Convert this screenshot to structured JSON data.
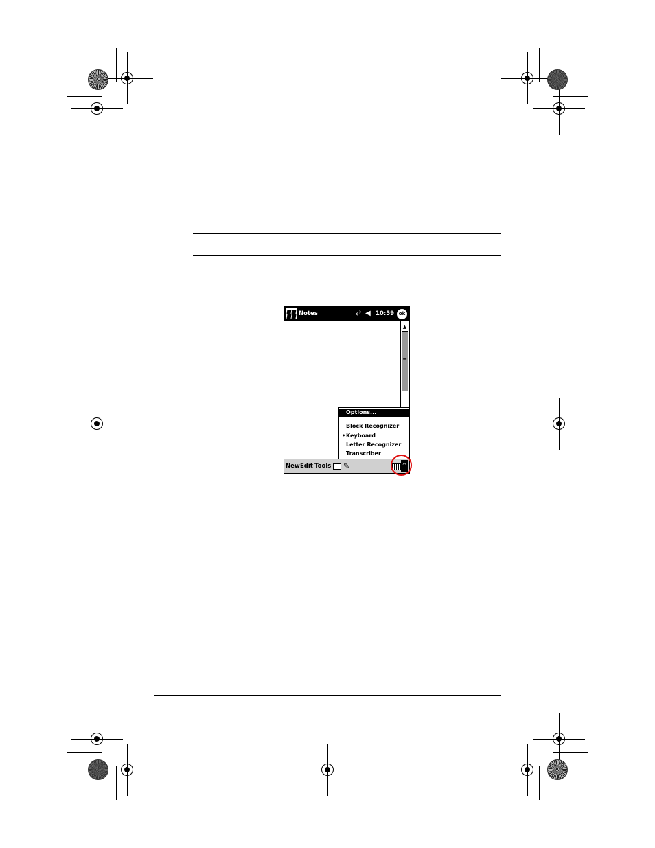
{
  "window": {
    "app_title": "Notes",
    "clock": "10:59",
    "ok_label": "ok"
  },
  "input_menu": {
    "items": [
      {
        "label": "Options...",
        "selected": false,
        "highlighted": true
      },
      {
        "label": "Block Recognizer",
        "selected": false
      },
      {
        "label": "Keyboard",
        "selected": true,
        "bullet": "•"
      },
      {
        "label": "Letter Recognizer",
        "selected": false
      },
      {
        "label": "Transcriber",
        "selected": false
      }
    ]
  },
  "menubar": {
    "new_label": "New",
    "edit_label": "Edit",
    "tools_label": "Tools"
  },
  "icons": {
    "start": "windows-flag-icon",
    "connectivity": "connectivity-icon",
    "speaker": "speaker-muted-icon",
    "recorder": "recorder-icon",
    "pen": "pen-icon",
    "keyboard": "keyboard-icon",
    "input_arrow": "input-selector-arrow-icon"
  },
  "colors": {
    "highlight_circle": "#e01010",
    "titlebar": "#000000",
    "menubar": "#d0d0d0"
  }
}
